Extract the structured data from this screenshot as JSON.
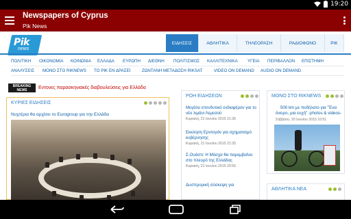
{
  "status_bar": {
    "time": "19:20"
  },
  "app_bar": {
    "title": "Newspapers of Cyprus",
    "subtitle": "Pik News"
  },
  "logo": {
    "text": "Pik",
    "sub": "news"
  },
  "top_nav": [
    "ΕΙΔΗΣΕΙΣ",
    "ΑΘΛΗΤΙΚΑ",
    "ΤΗΛΕΟΡΑΣΗ",
    "ΡΑΔΙΟΦΩΝΟ",
    "ΡΙΚ"
  ],
  "sub_nav_1": [
    "ΠΟΛΙΤΙΚΗ",
    "ΟΙΚΟΝΟΜΙΑ",
    "ΚΟΙΝΩΝΙΑ",
    "ΕΛΛΑΔΑ",
    "ΕΥΡΩΠΗ",
    "ΔΙΕΘΝΗ",
    "ΠΟΛΙΤΙΣΜΟΣ",
    "ΚΑΛΛΙΤΕΧΝΙΚΑ",
    "ΥΓΕΙΑ",
    "ΠΕΡΙΒΑΛΛΟΝ",
    "ΕΠΙΣΤΗΜΗ"
  ],
  "sub_nav_2": [
    "ΑΝΑΛΥΣΕΙΣ",
    "ΜΟΝΟ ΣΤΟ RIKNEWS",
    "ΤΟ ΡΙΚ ΕΝ ΔΡΑΣΕΙ",
    "ΖΩΝΤΑΝΗ ΜΕΤΑΔΟΣΗ RIKSAT",
    "VIDEO ON DEMAND",
    "AUDIO ON DEMAND"
  ],
  "breaking": {
    "badge_line1": "BREAKING",
    "badge_line2": "NEWS",
    "text": "Εντονες παρασκηνιακές διαβουλεύσεις για Ελλάδα"
  },
  "main": {
    "heading": "ΚΥΡΙΕΣ ΕΙΔΗΣΕΙΣ",
    "headline": "Νυχτέρια θα αρχίσει το Eurogroup για την Ελλάδα"
  },
  "news_flow": {
    "heading": "ΡΟΗ ΕΙΔΗΣΕΩΝ",
    "items": [
      {
        "title": "Μεγάλο επενδυτικό ενδιαφέρον για το νέο λιμάνι Λεμεσού",
        "date": "Κυριακή, 21 Ιουνίου 2015 21:36"
      },
      {
        "title": "Εκκληση Ερντογάν για σχηματισμό κυβέρνησης",
        "date": "Κυριακή, 21 Ιουνίου 2015 21:35"
      },
      {
        "title": "Σ.Ουάστι: Η Μόσχα θα παρεμβαίνει στο πλευρό της Ελλάδας",
        "date": "Κυριακή, 21 Ιουνίου 2015 20:55"
      },
      {
        "title": "Δυσπρορική σύσκεψη για",
        "date": ""
      }
    ]
  },
  "only_riknews": {
    "heading": "ΜΟΝΟ ΣΤΟ RIKNEWS",
    "title": "500 km με ποδήλατο για \"Ένα όνειρο, μια ευχή\" -photos & videos-",
    "date": "Σάββατο, 20 Ιουνίου 2015 10:51"
  },
  "sports": {
    "heading": "ΑΘΛΗΤΙΚΑ ΝΕΑ"
  }
}
